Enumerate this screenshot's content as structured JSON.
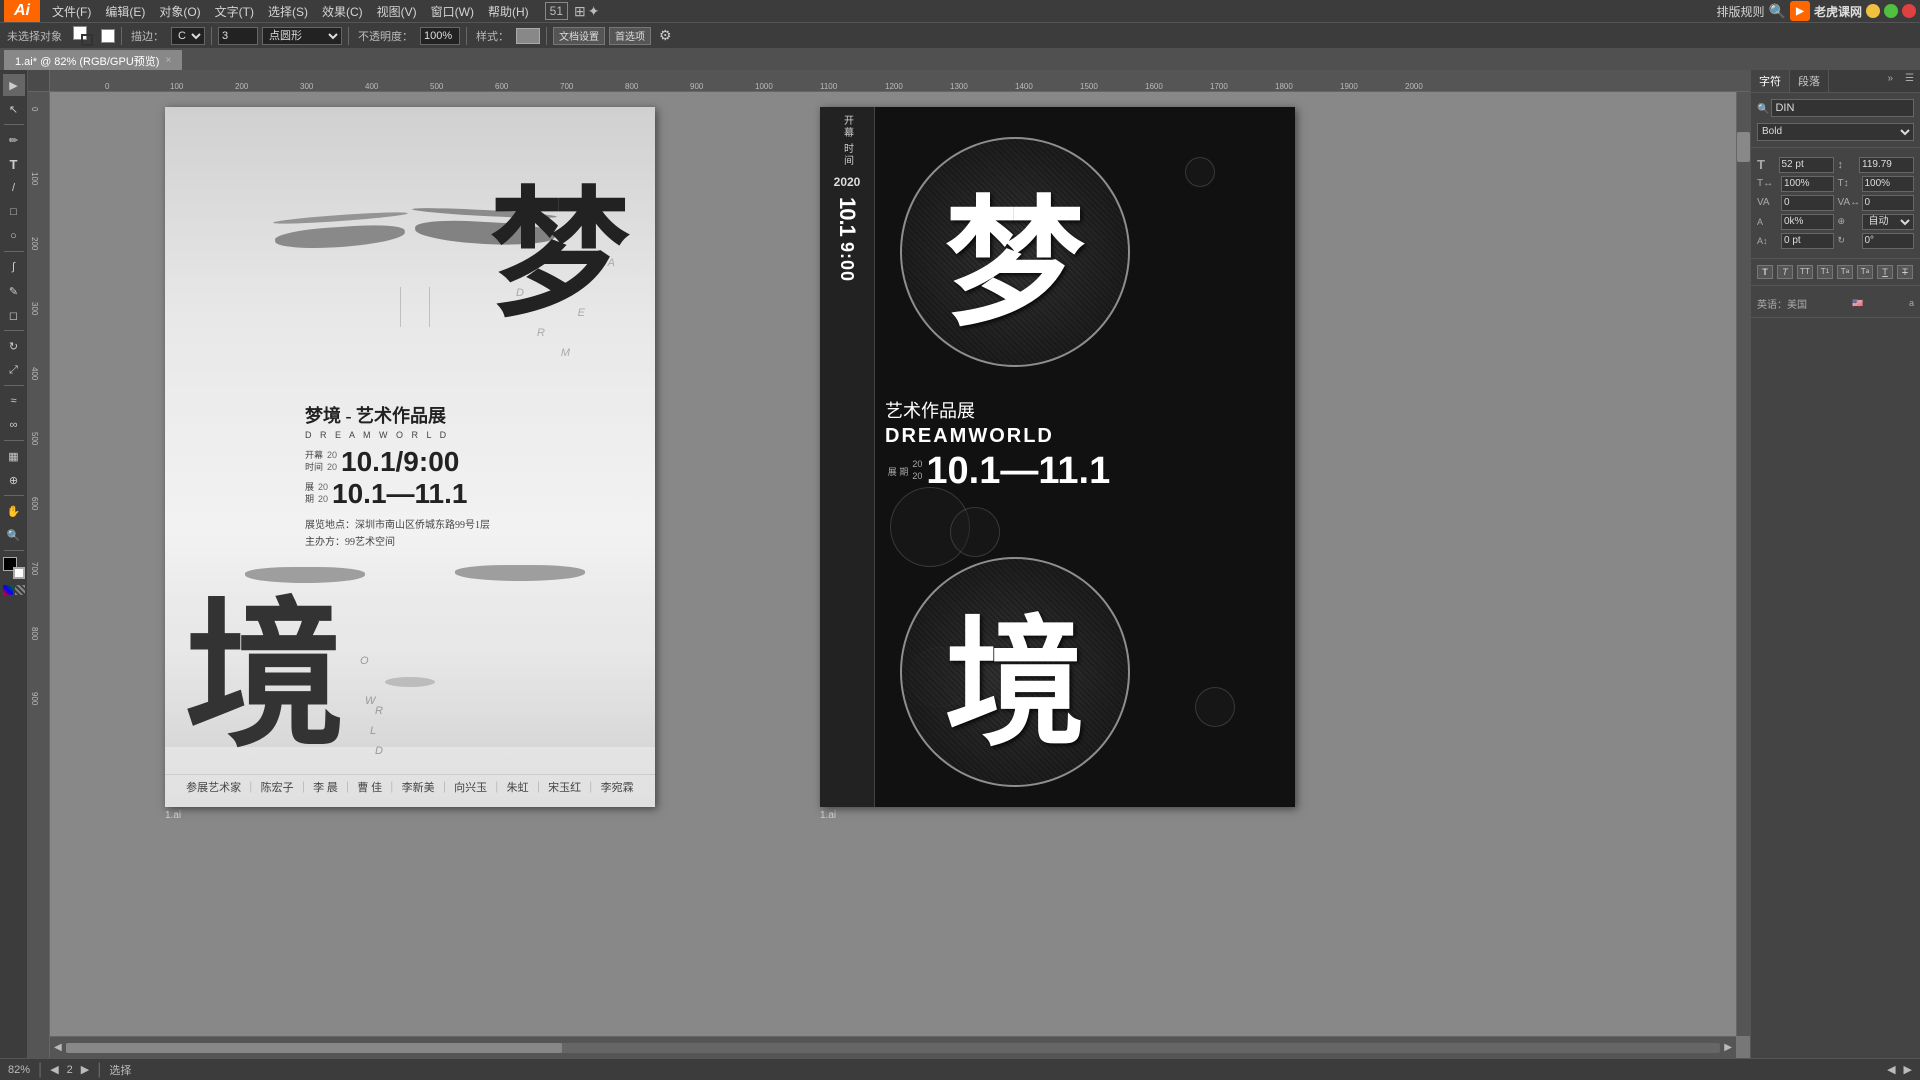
{
  "app": {
    "logo": "Ai",
    "title": "Adobe Illustrator"
  },
  "menubar": {
    "items": [
      "文件(F)",
      "编辑(E)",
      "对象(O)",
      "文字(T)",
      "选择(S)",
      "效果(C)",
      "视图(V)",
      "窗口(W)",
      "帮助(H)"
    ],
    "right_label": "排版规则",
    "logo_label": "老虎课网"
  },
  "toolbar": {
    "no_selection": "未选择对象",
    "stroke_width": "3",
    "stroke_type": "点圆形",
    "opacity_label": "不透明度：",
    "opacity_value": "100%",
    "style_label": "样式：",
    "doc_settings": "文档设置",
    "preferences": "首选项"
  },
  "tabbar": {
    "tab_name": "1.ai* @ 82% (RGB/GPU预览)",
    "close": "×"
  },
  "white_poster": {
    "char_top": "梦",
    "dream_text": "D R E A M",
    "letters_scattered": [
      "D",
      "R",
      "E",
      "A",
      "M"
    ],
    "title": "梦境 - 艺术作品展",
    "subtitle": "D R E A M W O R L D",
    "opening_label": "开幕\n时间",
    "opening_year": "20\n20",
    "opening_date": "10.1/9:00",
    "period_label": "展\n期",
    "period_year": "20\n20",
    "period_date": "10.1—11.1",
    "address": "展览地点：深圳市南山区侨城东路99号1层",
    "organizer": "主办方：99艺术空间",
    "char_bottom": "境",
    "world_letters": [
      "W",
      "O",
      "R",
      "L",
      "D"
    ],
    "artists": [
      "参展艺术家",
      "陈宏子",
      "李 晨",
      "曹 佳",
      "李新美",
      "向兴玉",
      "朱虹",
      "宋玉红",
      "李宛霖"
    ]
  },
  "black_poster": {
    "sidebar_open": "开幕",
    "sidebar_time": "时间",
    "year": "2020",
    "date_v": "10.1",
    "time_v": "9:00",
    "char_top": "梦",
    "art_title": "艺术作品展",
    "dreamworld": "DREAMWORLD",
    "period_label": "展\n期",
    "period_year": "20\n20",
    "period_date": "10.1—11.1",
    "char_bottom": "境"
  },
  "right_panel": {
    "tab1": "字符",
    "tab2": "段落",
    "font_name": "DIN",
    "font_weight": "Bold",
    "size_label": "T",
    "size_value": "52 pt",
    "leading_label": "↕",
    "leading_value": "119.79",
    "scale_h_label": "T",
    "scale_h_value": "100%",
    "scale_v_label": "T",
    "scale_v_value": "100%",
    "tracking_label": "VA",
    "tracking_value": "0",
    "baseline_label": "A↕",
    "baseline_value": "0",
    "color_label": "A",
    "color_value": "0k%",
    "lang_label": "英语：美国",
    "lang_sup": "a"
  },
  "statusbar": {
    "zoom": "82%",
    "nav_prev": "◀",
    "page_num": "2",
    "nav_next": "▶",
    "selection": "选择",
    "scroll_left": "◀",
    "scroll_right": "▶"
  }
}
